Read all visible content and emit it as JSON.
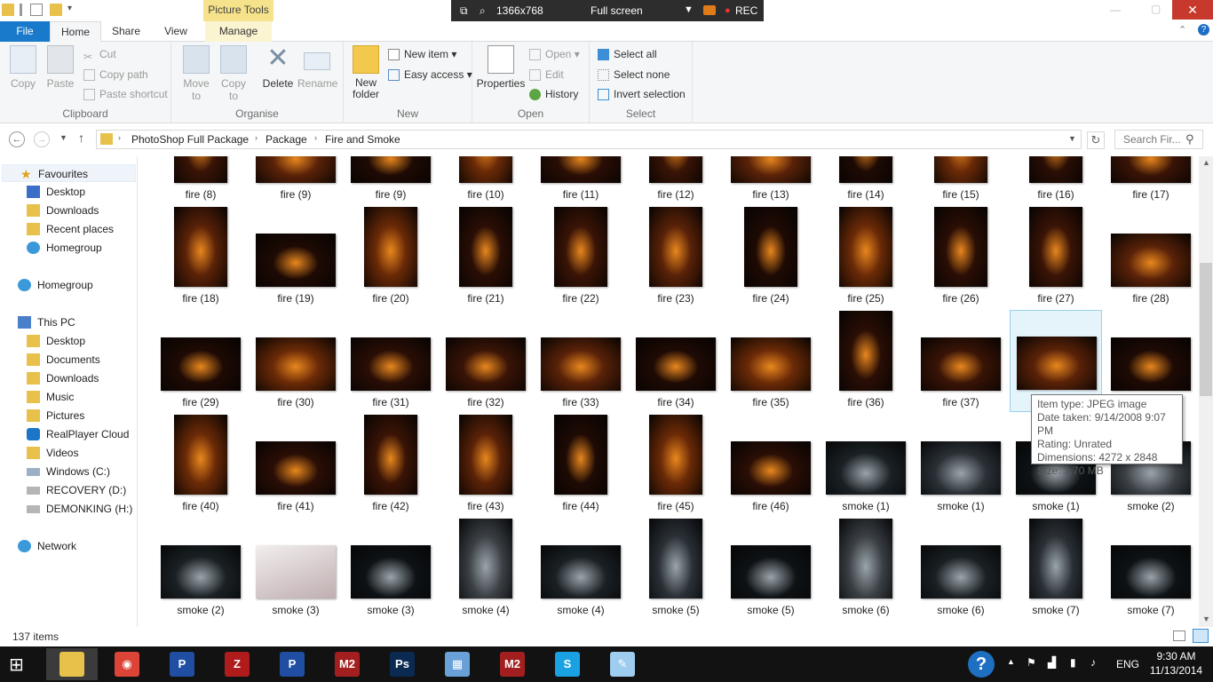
{
  "titlebar": {
    "picture_tools": "Picture Tools",
    "recorder": {
      "resolution": "1366x768",
      "mode": "Full screen",
      "rec": "REC"
    }
  },
  "ribbon_tabs": {
    "file": "File",
    "home": "Home",
    "share": "Share",
    "view": "View",
    "manage": "Manage"
  },
  "ribbon": {
    "clipboard": {
      "label": "Clipboard",
      "copy": "Copy",
      "paste": "Paste",
      "cut": "Cut",
      "copy_path": "Copy path",
      "paste_shortcut": "Paste shortcut"
    },
    "organise": {
      "label": "Organise",
      "move_to": "Move to",
      "copy_to": "Copy to",
      "delete": "Delete",
      "rename": "Rename"
    },
    "new": {
      "label": "New",
      "new_folder": "New folder",
      "new_item": "New item",
      "easy_access": "Easy access"
    },
    "open": {
      "label": "Open",
      "properties": "Properties",
      "open": "Open",
      "edit": "Edit",
      "history": "History"
    },
    "select": {
      "label": "Select",
      "select_all": "Select all",
      "select_none": "Select none",
      "invert_selection": "Invert selection"
    }
  },
  "address": {
    "crumbs": [
      "PhotoShop Full Package",
      "Package",
      "Fire and Smoke"
    ],
    "search_placeholder": "Search Fir..."
  },
  "nav": {
    "favourites": "Favourites",
    "favourites_items": [
      "Desktop",
      "Downloads",
      "Recent places",
      "Homegroup"
    ],
    "homegroup": "Homegroup",
    "this_pc": "This PC",
    "this_pc_items": [
      "Desktop",
      "Documents",
      "Downloads",
      "Music",
      "Pictures",
      "RealPlayer Cloud",
      "Videos",
      "Windows (C:)",
      "RECOVERY (D:)",
      "DEMONKING (H:)"
    ],
    "network": "Network"
  },
  "files": [
    [
      "fire (8)",
      "fire (9)",
      "fire (9)",
      "fire (10)",
      "fire (11)",
      "fire (12)",
      "fire (13)",
      "fire (14)",
      "fire (15)",
      "fire (16)",
      "fire (17)"
    ],
    [
      "fire (18)",
      "fire (19)",
      "fire (20)",
      "fire (21)",
      "fire (22)",
      "fire (23)",
      "fire (24)",
      "fire (25)",
      "fire (26)",
      "fire (27)",
      "fire (28)"
    ],
    [
      "fire (29)",
      "fire (30)",
      "fire (31)",
      "fire (32)",
      "fire (33)",
      "fire (34)",
      "fire (35)",
      "fire (36)",
      "fire (37)",
      "",
      ""
    ],
    [
      "fire (40)",
      "fire (41)",
      "fire (42)",
      "fire (43)",
      "fire (44)",
      "fire (45)",
      "fire (46)",
      "smoke (1)",
      "smoke (1)",
      "smoke (1)",
      "smoke (2)"
    ],
    [
      "smoke (2)",
      "smoke (3)",
      "smoke (3)",
      "smoke (4)",
      "smoke (4)",
      "smoke (5)",
      "smoke (5)",
      "smoke (6)",
      "smoke (6)",
      "smoke (7)",
      "smoke (7)"
    ]
  ],
  "tooltip": {
    "item_type": "Item type: JPEG image",
    "date_taken": "Date taken: 9/14/2008 9:07 PM",
    "rating": "Rating: Unrated",
    "dimensions": "Dimensions: 4272 x 2848",
    "size": "Size: 1.70 MB"
  },
  "status": {
    "item_count": "137 items"
  },
  "taskbar": {
    "lang": "ENG",
    "time": "9:30 AM",
    "date": "11/13/2014",
    "apps": [
      "file-explorer",
      "chrome",
      "app-p",
      "app-z",
      "app-p",
      "app-m2",
      "photoshop",
      "calculator",
      "app-m2",
      "skype",
      "notepad"
    ]
  },
  "colors": {
    "file_tab": "#1979ca",
    "picture_tools": "#f5e28a",
    "close": "#c7392c",
    "selection": "#e5f3fb"
  }
}
